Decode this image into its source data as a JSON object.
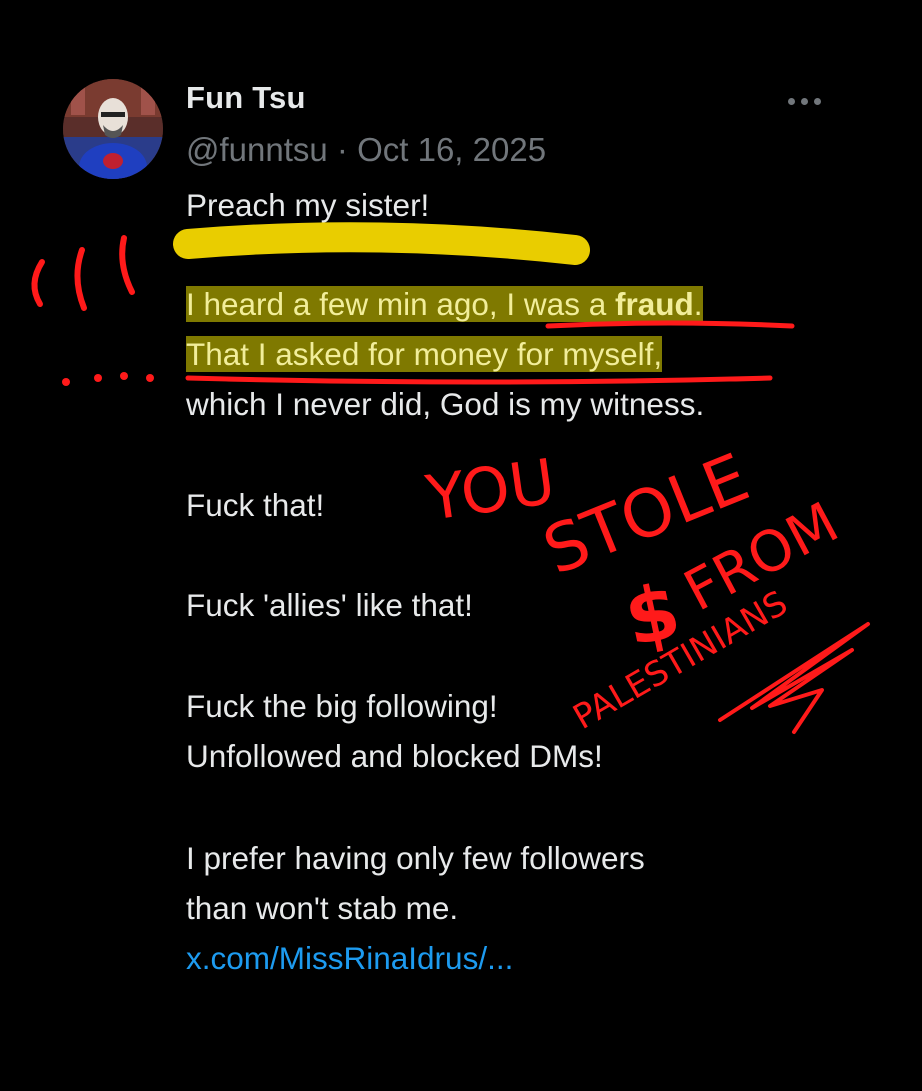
{
  "author": {
    "display_name": "Fun Tsu",
    "handle": "@funntsu",
    "separator": "·",
    "date": "Oct 16, 2025"
  },
  "more_icon": "more-horizontal-icon",
  "tweet": {
    "line1": "Preach my sister!",
    "line2a": "I heard a few min ago, I was a ",
    "line2b": "fraud",
    "line2c": ".",
    "line3": "That I asked for money for myself,",
    "line4": "which I never did, God is my witness.",
    "line5": "Fuck that!",
    "line6": "Fuck 'allies' like that!",
    "line7": "Fuck the big following!",
    "line8": "Unfollowed and blocked DMs!",
    "line9": "I prefer having only few followers",
    "line10": "than won't stab me.",
    "link": "x.com/MissRinaIdrus/..."
  },
  "annotations": {
    "you": "YOU",
    "stole": "STOLE",
    "from": "FROM",
    "dollar": "$",
    "palestinians": "PALESTINIANS",
    "colors": {
      "marker": "#ff1a1a",
      "highlighter": "#f5d800"
    }
  }
}
